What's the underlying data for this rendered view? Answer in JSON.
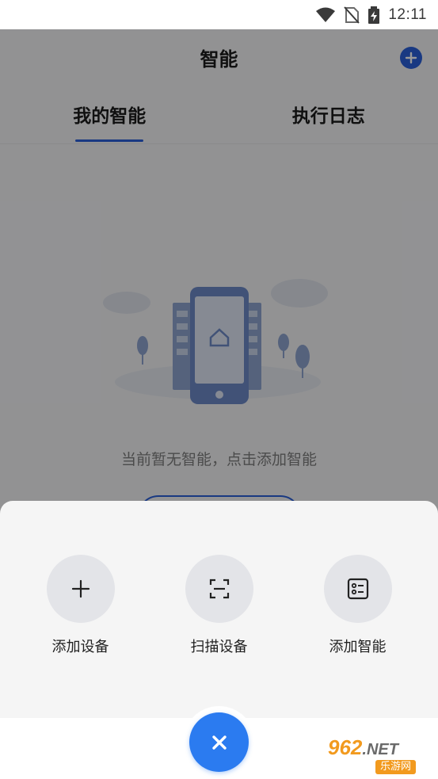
{
  "status_bar": {
    "time": "12:11",
    "icons": [
      "wifi-icon",
      "no-sim-icon",
      "battery-charging-icon"
    ]
  },
  "header": {
    "title": "智能",
    "add_icon": "plus-circle-icon"
  },
  "tabs": [
    {
      "label": "我的智能",
      "active": true
    },
    {
      "label": "执行日志",
      "active": false
    }
  ],
  "empty_state": {
    "message": "当前暂无智能，点击添加智能"
  },
  "sheet": {
    "actions": [
      {
        "label": "添加设备",
        "icon": "plus-icon"
      },
      {
        "label": "扫描设备",
        "icon": "scan-icon"
      },
      {
        "label": "添加智能",
        "icon": "list-icon"
      }
    ]
  },
  "close_button": {
    "icon": "close-icon"
  },
  "watermark": {
    "top": "962",
    "net": ".NET",
    "bottom": "乐游网"
  },
  "colors": {
    "accent": "#2b5fd9",
    "fab": "#2b7bf0",
    "sheet_bg": "#f5f5f5",
    "action_circle": "#e3e4e8"
  }
}
